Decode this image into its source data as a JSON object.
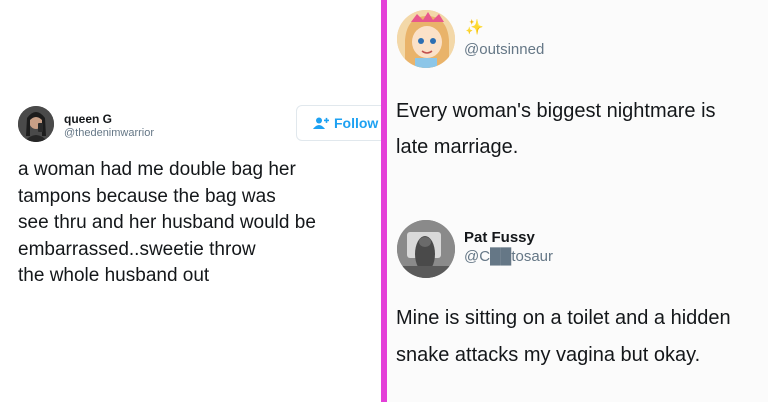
{
  "colors": {
    "divider": "#e43fd8",
    "link_blue": "#1da1f2",
    "handle_gray": "#657786"
  },
  "left_tweet": {
    "name": "queen G",
    "handle": "@thedenimwarrior",
    "follow_label": "Follow",
    "follow_icon": "add-user-icon",
    "text": "a woman had me double bag her\ntampons because the bag was\nsee thru and her husband would be\nembarrassed..sweetie throw\nthe whole husband out"
  },
  "right_tweets": [
    {
      "handle": "@outsinned",
      "decoration": "sparkle-icon",
      "text": "Every woman's biggest nightmare is\nlate marriage."
    },
    {
      "name": "Pat Fussy",
      "handle": "@C██tosaur",
      "text": "Mine is sitting on a toilet and a hidden\nsnake attacks my vagina but okay."
    }
  ]
}
